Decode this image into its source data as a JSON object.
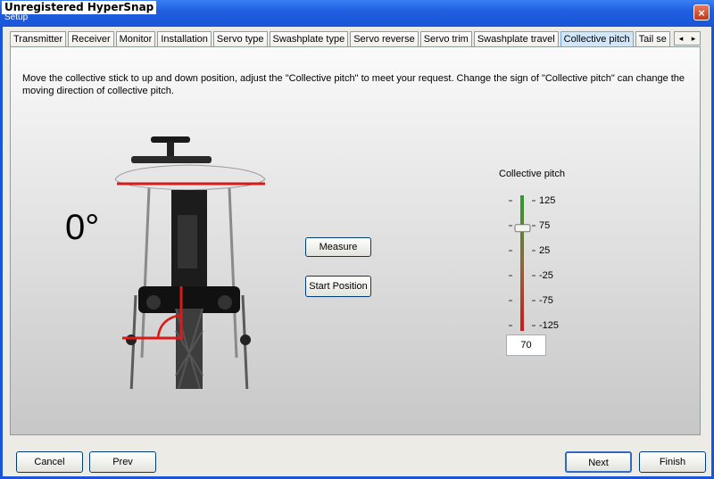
{
  "window": {
    "title": "Setup",
    "watermark": "Unregistered HyperSnap",
    "close_glyph": "×"
  },
  "tabs": [
    {
      "label": "Transmitter"
    },
    {
      "label": "Receiver"
    },
    {
      "label": "Monitor"
    },
    {
      "label": "Installation"
    },
    {
      "label": "Servo type"
    },
    {
      "label": "Swashplate type"
    },
    {
      "label": "Servo reverse"
    },
    {
      "label": "Servo trim"
    },
    {
      "label": "Swashplate travel"
    },
    {
      "label": "Collective pitch",
      "active": true
    },
    {
      "label": "Tail se"
    }
  ],
  "tab_scroll": {
    "left": "◂",
    "right": "▸"
  },
  "main": {
    "instruction": "Move the collective stick to up and down position, adjust the \"Collective pitch\" to meet your request. Change the sign of \"Collective pitch\" can change the moving direction of collective pitch.",
    "angle_display": "0°",
    "measure_label": "Measure",
    "start_position_label": "Start Position"
  },
  "collective_pitch": {
    "label": "Collective pitch",
    "ticks": [
      "125",
      "75",
      "25",
      "-25",
      "-75",
      "-125"
    ],
    "value": "70",
    "range": [
      -125,
      125
    ],
    "slider_value": 70,
    "colors": {
      "top": "#2e9a2e",
      "bottom": "#d01818"
    }
  },
  "footer": {
    "cancel_label": "Cancel",
    "prev_label": "Prev",
    "next_label": "Next",
    "finish_label": "Finish"
  }
}
